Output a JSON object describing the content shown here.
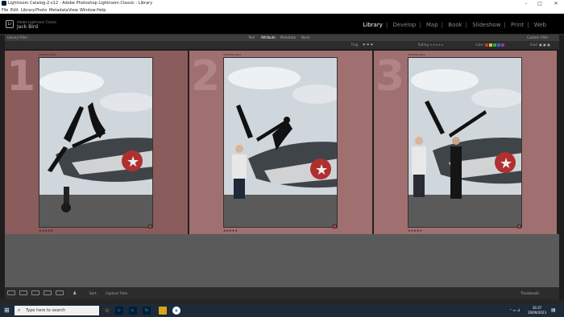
{
  "window": {
    "title": "Lightroom Catalog-2-v12 - Adobe Photoshop Lightroom Classic - Library"
  },
  "menu": [
    "File",
    "Edit",
    "Library",
    "Photo",
    "Metadata",
    "View",
    "Window",
    "Help"
  ],
  "identity": {
    "line1": "Adobe Lightroom Classic",
    "line2": "Jack Bird"
  },
  "modules": [
    "Library",
    "Develop",
    "Map",
    "Book",
    "Slideshow",
    "Print",
    "Web"
  ],
  "active_module": "Library",
  "filter_bar": {
    "title": "Library Filter :",
    "tabs": [
      "Text",
      "Attribute",
      "Metadata",
      "None"
    ],
    "active_tab": "Attribute",
    "preset": "Custom Filter"
  },
  "attribute_bar": {
    "edits_label": "Flag",
    "rating_label": "Rating",
    "color_label": "Color",
    "kind_label": "Kind"
  },
  "photos": [
    {
      "num": "1",
      "label": "SPITFIRE-AREA",
      "stars": "★★★★★"
    },
    {
      "num": "2",
      "label": "SPITFIRE-AREA",
      "stars": "★★★★★"
    },
    {
      "num": "3",
      "label": "SPITFIRE-AREA",
      "stars": "★★★★★"
    }
  ],
  "bottom": {
    "sort_label": "Sort:",
    "sort_value": "Capture Time",
    "thumb_label": "Thumbnails"
  },
  "taskbar": {
    "search_placeholder": "Type here to search",
    "time": "16:37",
    "date": "20/09/2023"
  },
  "colors": {
    "cell_bg": "#a07070",
    "module_active": "#ffffff",
    "taskbar": "#1c2a3a"
  }
}
